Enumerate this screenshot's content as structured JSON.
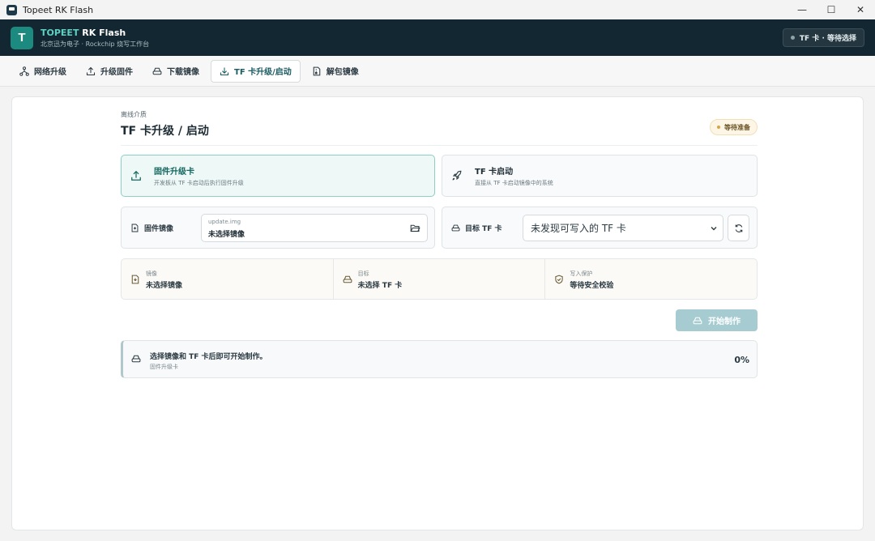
{
  "window": {
    "title": "Topeet RK Flash",
    "controls": {
      "minimize": "—",
      "maximize": "☐",
      "close": "✕"
    }
  },
  "header": {
    "logo_letter": "T",
    "brand_name": "TOPEET",
    "app_name": "RK Flash",
    "subtitle": "北京迅为电子 · Rockchip 烧写工作台",
    "status": "TF 卡 · 等待选择"
  },
  "tabs": [
    {
      "label": "网络升级",
      "icon": "network-icon"
    },
    {
      "label": "升级固件",
      "icon": "upload-icon"
    },
    {
      "label": "下载镜像",
      "icon": "drive-icon"
    },
    {
      "label": "TF 卡升级/启动",
      "icon": "download-icon",
      "active": true
    },
    {
      "label": "解包镜像",
      "icon": "file-archive-icon"
    }
  ],
  "page": {
    "eyebrow": "离线介质",
    "title": "TF 卡升级 / 启动",
    "badge": "等待准备"
  },
  "modes": [
    {
      "title": "固件升级卡",
      "desc": "开发板从 TF 卡启动后执行固件升级",
      "icon": "upload-icon",
      "selected": true
    },
    {
      "title": "TF 卡启动",
      "desc": "直接从 TF 卡启动镜像中的系统",
      "icon": "rocket-icon",
      "selected": false
    }
  ],
  "image_field": {
    "label": "固件镜像",
    "placeholder": "update.img",
    "value": "未选择镜像"
  },
  "target_field": {
    "label": "目标 TF 卡",
    "selected": "未发现可写入的 TF 卡"
  },
  "summary": [
    {
      "key": "镜像",
      "value": "未选择镜像",
      "icon": "file-icon"
    },
    {
      "key": "目标",
      "value": "未选择 TF 卡",
      "icon": "drive-icon"
    },
    {
      "key": "写入保护",
      "value": "等待安全校验",
      "icon": "shield-icon"
    }
  ],
  "start_button": "开始制作",
  "progress": {
    "message": "选择镜像和 TF 卡后即可开始制作。",
    "sub": "固件升级卡",
    "percent": "0%"
  },
  "colors": {
    "header_bg": "#122731",
    "accent": "#1d8a80",
    "start_btn": "#a6ccd2"
  }
}
